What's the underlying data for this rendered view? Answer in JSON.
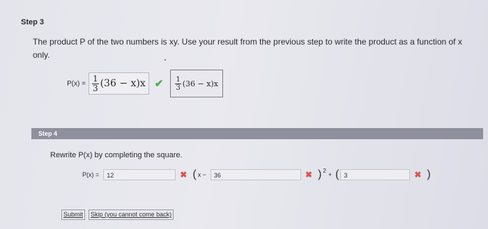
{
  "step3": {
    "title": "Step 3",
    "text": "The product P of the two numbers is xy. Use your result from the previous step to write the product as a function of x only.",
    "label": "P(x) =",
    "answer_num": "1",
    "answer_den": "3",
    "answer_tail": "(36 − x)x",
    "echo_num": "1",
    "echo_den": "3",
    "echo_tail": "(36 − x)x"
  },
  "step4": {
    "title": "Step 4",
    "text": "Rewrite P(x) by completing the square.",
    "label": "P(x) =",
    "field1": "12",
    "mid": "x −",
    "field2": "36",
    "field3": "3",
    "exponent": "2",
    "plus": "+"
  },
  "buttons": {
    "submit": "Submit",
    "skip": "Skip (you cannot come back)"
  },
  "colors": {
    "correct": "#4caf50",
    "incorrect": "#d9534f",
    "step_bar": "#8e909d"
  },
  "icons": {
    "correct": "check-icon",
    "incorrect": "x-icon"
  }
}
